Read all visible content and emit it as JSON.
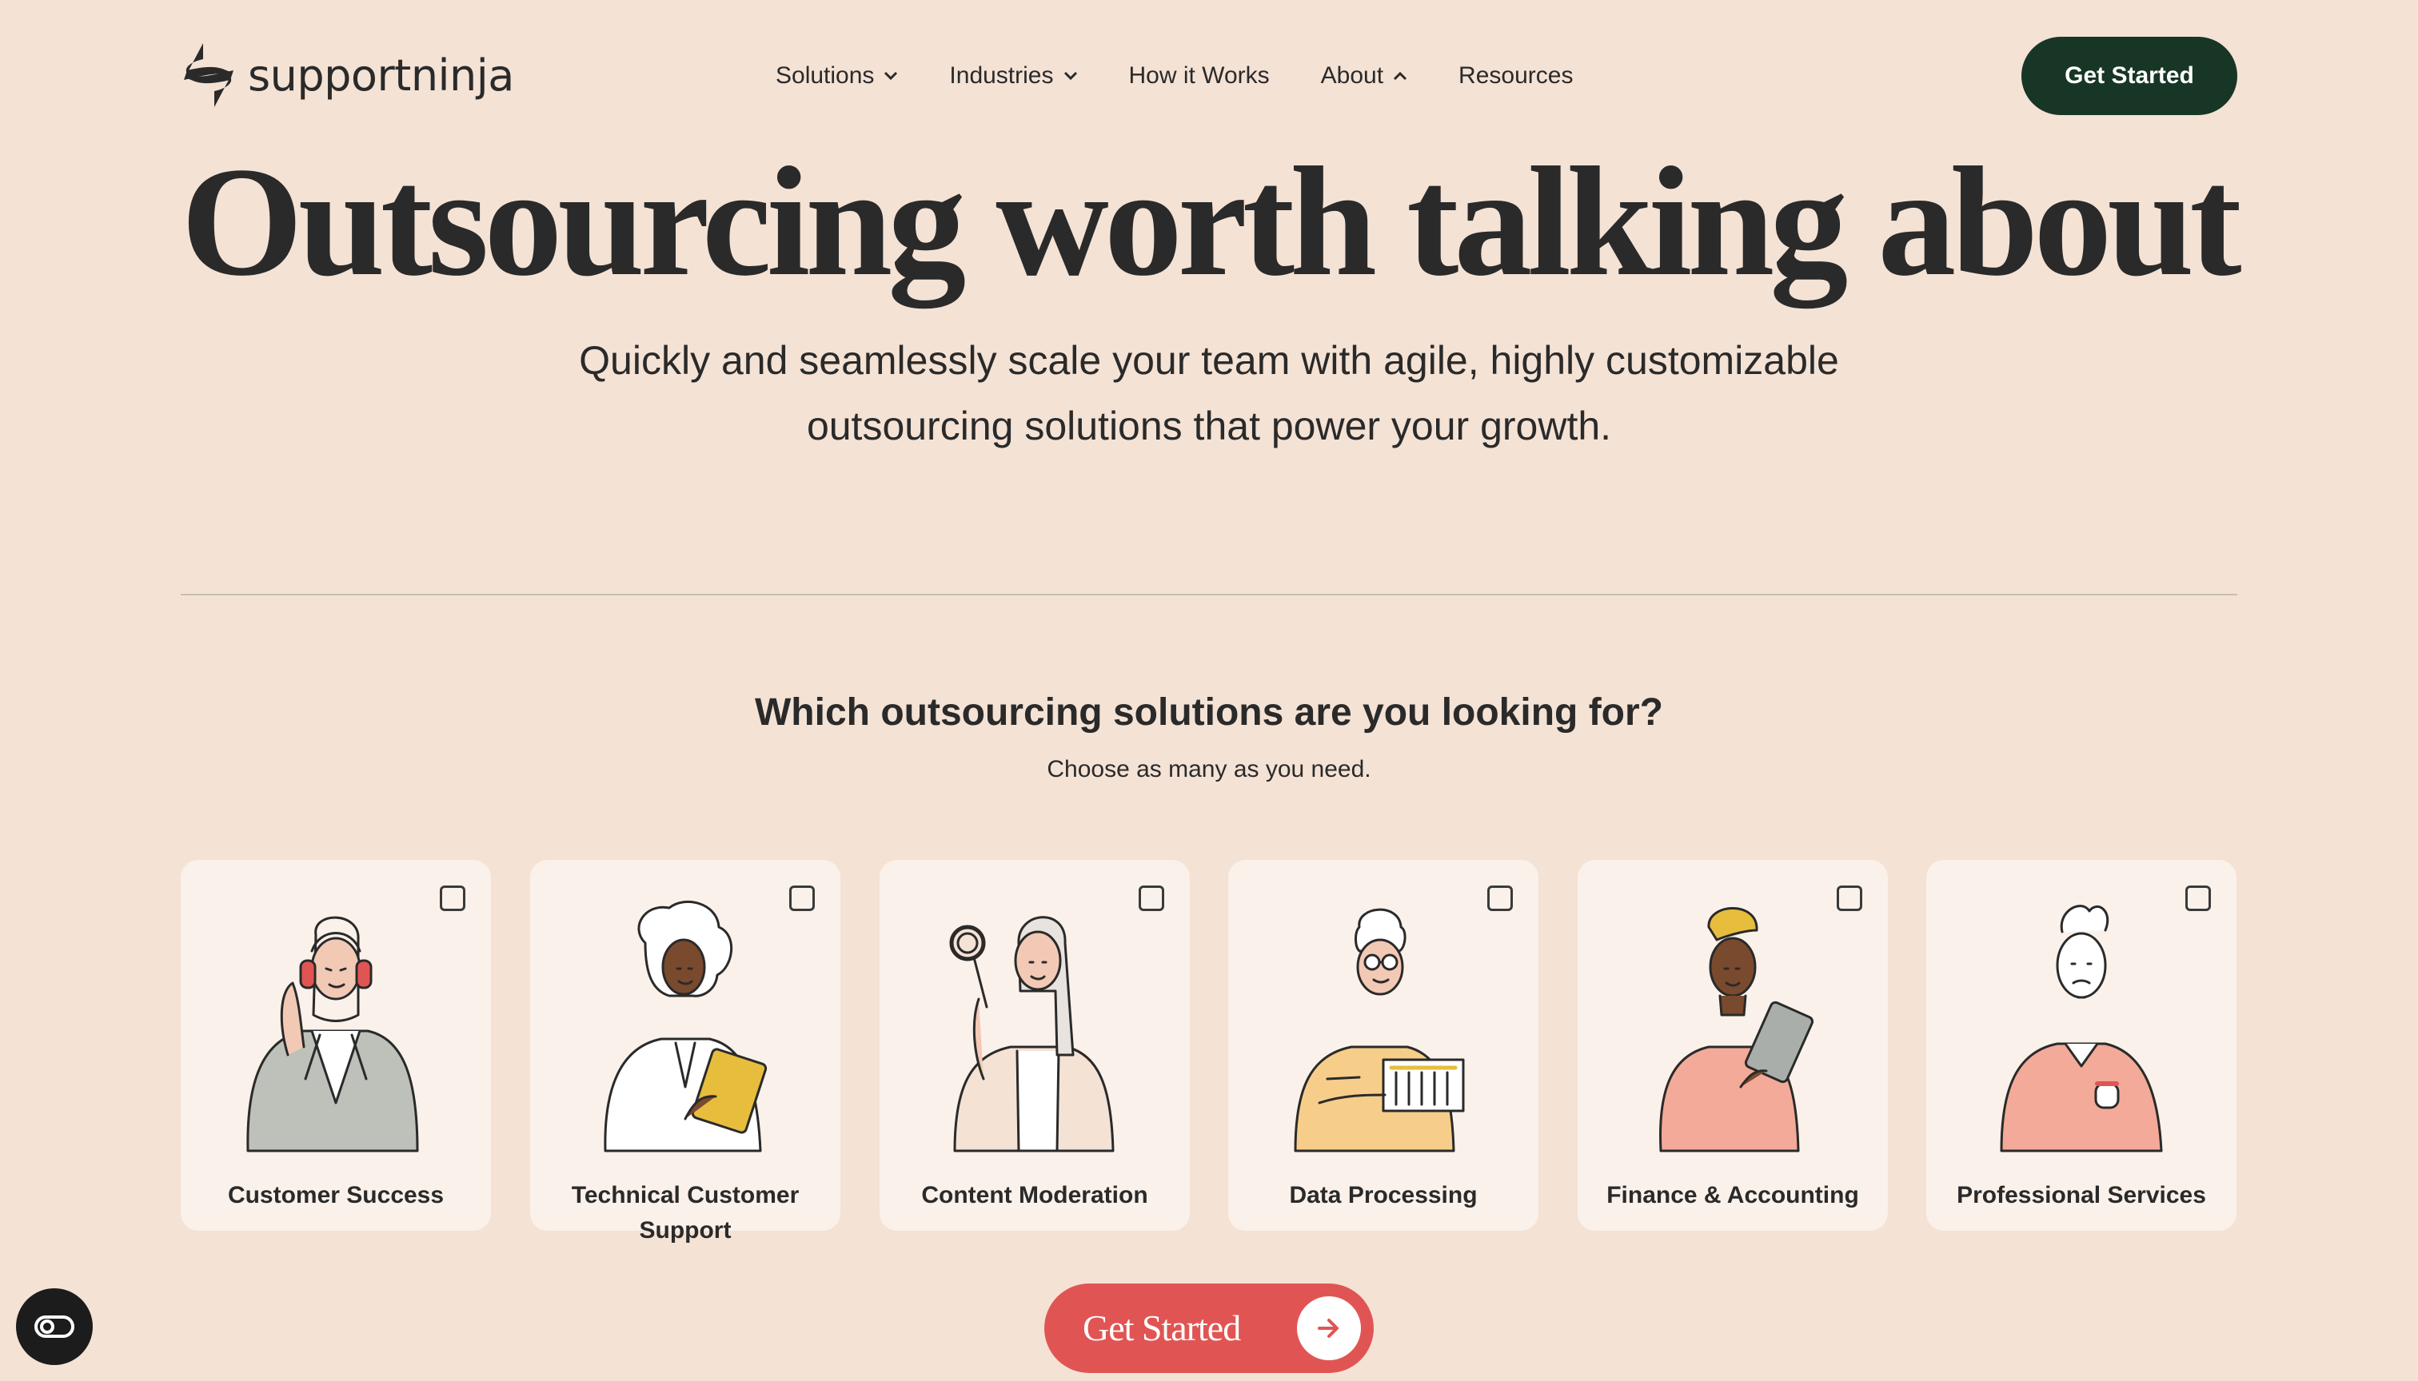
{
  "brand": {
    "name": "supportninja"
  },
  "nav": {
    "items": [
      {
        "label": "Solutions",
        "chevron": "down"
      },
      {
        "label": "Industries",
        "chevron": "down"
      },
      {
        "label": "How it Works",
        "chevron": "none"
      },
      {
        "label": "About",
        "chevron": "up"
      },
      {
        "label": "Resources",
        "chevron": "none"
      }
    ],
    "cta_label": "Get Started"
  },
  "hero": {
    "title": "Outsourcing worth talking about",
    "subtitle": "Quickly and seamlessly scale your team with agile, highly customizable outsourcing solutions that power your growth."
  },
  "picker": {
    "question": "Which outsourcing solutions are you looking for?",
    "hint": "Choose as many as you need.",
    "options": [
      {
        "label": "Customer Success",
        "checked": false,
        "illustration": "person-headset-icon"
      },
      {
        "label": "Technical Customer Support",
        "checked": false,
        "illustration": "person-tablet-icon"
      },
      {
        "label": "Content Moderation",
        "checked": false,
        "illustration": "person-magnifier-icon"
      },
      {
        "label": "Data Processing",
        "checked": false,
        "illustration": "person-chart-icon"
      },
      {
        "label": "Finance & Accounting",
        "checked": false,
        "illustration": "person-headwrap-tablet-icon"
      },
      {
        "label": "Professional Services",
        "checked": false,
        "illustration": "person-sweater-icon"
      }
    ]
  },
  "cta_bottom": {
    "label": "Get Started",
    "icon": "arrow-right-icon"
  },
  "accessibility": {
    "icon": "accessibility-toggle-icon"
  },
  "colors": {
    "background": "#f4e2d5",
    "card": "#faf1ea",
    "primary_dark": "#173625",
    "accent": "#e05553",
    "text": "#2a2a2a"
  }
}
